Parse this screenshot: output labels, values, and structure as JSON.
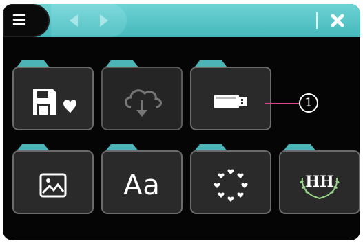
{
  "toolbar": {
    "menu_icon": "hamburger-menu-icon",
    "back_icon": "arrow-left-icon",
    "forward_icon": "arrow-right-icon",
    "close_icon": "close-x-icon"
  },
  "colors": {
    "toolbar_teal": "#4fbfc2",
    "folder_tab_teal": "#4cb3b6",
    "folder_body": "#2a2a2a",
    "folder_border": "#6b6b6b",
    "screen_background": "#050505",
    "callout_pink": "#e0468b"
  },
  "folders": [
    {
      "name": "saved-favorites-folder",
      "icon": "save-heart-icon",
      "state": "enabled"
    },
    {
      "name": "cloud-download-folder",
      "icon": "cloud-download-icon",
      "state": "disabled"
    },
    {
      "name": "usb-memory-folder",
      "icon": "usb-drive-icon",
      "state": "enabled"
    },
    {
      "name": "image-folder",
      "icon": "picture-icon",
      "state": "enabled"
    },
    {
      "name": "font-folder",
      "icon": "text-aa-icon",
      "label": "Aa",
      "state": "enabled"
    },
    {
      "name": "decorative-frame-folder",
      "icon": "heart-circle-icon",
      "state": "enabled"
    },
    {
      "name": "monogram-folder",
      "icon": "monogram-wreath-icon",
      "label": "HH",
      "state": "enabled"
    }
  ],
  "callout": {
    "number": "1",
    "target": "usb-memory-folder"
  }
}
